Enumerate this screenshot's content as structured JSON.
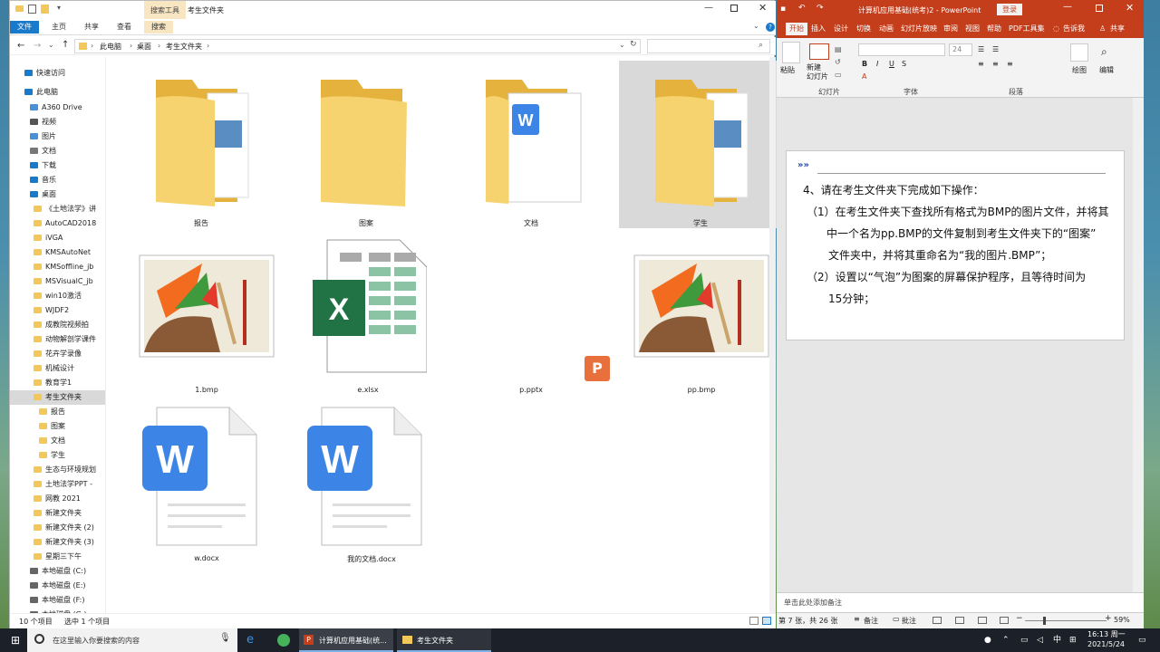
{
  "explorer": {
    "window_title": "考生文件夹",
    "context_tab_group": "搜索工具",
    "ribbon_tabs": [
      "文件",
      "主页",
      "共享",
      "查看",
      "搜索"
    ],
    "breadcrumb": [
      "此电脑",
      "桌面",
      "考生文件夹"
    ],
    "search_placeholder": "",
    "nav_items": [
      {
        "label": "快速访问",
        "kind": "star"
      },
      {
        "label": "此电脑",
        "kind": "pc"
      },
      {
        "label": "A360 Drive",
        "kind": "cloud"
      },
      {
        "label": "视频",
        "kind": "video"
      },
      {
        "label": "图片",
        "kind": "image"
      },
      {
        "label": "文档",
        "kind": "doc"
      },
      {
        "label": "下载",
        "kind": "download"
      },
      {
        "label": "音乐",
        "kind": "music"
      },
      {
        "label": "桌面",
        "kind": "desktop"
      },
      {
        "label": "《土地法学》讲",
        "kind": "folder"
      },
      {
        "label": "AutoCAD2018",
        "kind": "folder"
      },
      {
        "label": "iVGA",
        "kind": "folder"
      },
      {
        "label": "KMSAutoNet",
        "kind": "folder"
      },
      {
        "label": "KMSoffline_jb",
        "kind": "folder"
      },
      {
        "label": "MSVisualC_jb",
        "kind": "folder"
      },
      {
        "label": "win10激活",
        "kind": "folder"
      },
      {
        "label": "WJDF2",
        "kind": "folder"
      },
      {
        "label": "成教院视频拍",
        "kind": "folder"
      },
      {
        "label": "动物解剖学课件",
        "kind": "folder"
      },
      {
        "label": "花卉学录像",
        "kind": "folder"
      },
      {
        "label": "机械设计",
        "kind": "folder"
      },
      {
        "label": "教育学1",
        "kind": "folder"
      },
      {
        "label": "考生文件夹",
        "kind": "folder"
      },
      {
        "label": "报告",
        "kind": "folder"
      },
      {
        "label": "图案",
        "kind": "folder"
      },
      {
        "label": "文档",
        "kind": "folder"
      },
      {
        "label": "学生",
        "kind": "folder"
      },
      {
        "label": "生态与环境规划",
        "kind": "folder"
      },
      {
        "label": "土地法学PPT - ",
        "kind": "folder"
      },
      {
        "label": "网教 2021",
        "kind": "folder"
      },
      {
        "label": "新建文件夹",
        "kind": "folder"
      },
      {
        "label": "新建文件夹 (2)",
        "kind": "folder"
      },
      {
        "label": "新建文件夹 (3)",
        "kind": "folder"
      },
      {
        "label": "星期三下午",
        "kind": "folder"
      },
      {
        "label": "本地磁盘 (C:)",
        "kind": "drive"
      },
      {
        "label": "本地磁盘 (E:)",
        "kind": "drive"
      },
      {
        "label": "本地磁盘 (F:)",
        "kind": "drive"
      },
      {
        "label": "本地磁盘 (G:)",
        "kind": "drive"
      }
    ],
    "files": [
      {
        "name": "报告",
        "type": "folder"
      },
      {
        "name": "图案",
        "type": "folder"
      },
      {
        "name": "文档",
        "type": "folder"
      },
      {
        "name": "学生",
        "type": "folder",
        "selected": true
      },
      {
        "name": "1.bmp",
        "type": "bmp"
      },
      {
        "name": "e.xlsx",
        "type": "xlsx"
      },
      {
        "name": "p.pptx",
        "type": "pptx"
      },
      {
        "name": "pp.bmp",
        "type": "bmp"
      },
      {
        "name": "w.docx",
        "type": "docx"
      },
      {
        "name": "我的文档.docx",
        "type": "docx"
      }
    ],
    "status_count": "10 个项目",
    "status_selected": "选中 1 个项目"
  },
  "ppt": {
    "title": "计算机应用基础(统考)2  -  PowerPoint",
    "login_label": "登录",
    "tabs": [
      "开始",
      "插入",
      "设计",
      "切换",
      "动画",
      "幻灯片放映",
      "审阅",
      "视图",
      "帮助",
      "PDF工具集",
      "告诉我",
      "共享"
    ],
    "ribbon_groups": [
      "幻灯片",
      "字体",
      "段落"
    ],
    "new_slide_label": "新建\n幻灯片",
    "paste_label": "粘贴",
    "drawing_label": "绘图",
    "edit_label": "编辑",
    "font_size": "24",
    "slide_lines": [
      "4、请在考生文件夹下完成如下操作：",
      "（1）在考生文件夹下查找所有格式为BMP的图片文件，并将其",
      "中一个名为pp.BMP的文件复制到考生文件夹下的“图案”",
      "文件夹中，并将其重命名为“我的图片.BMP”；",
      "（2）设置以“气泡”为图案的屏幕保护程序，且等待时间为",
      "15分钟；"
    ],
    "notes_placeholder": "单击此处添加备注",
    "status_slide": "第 7 张，共 26 张",
    "status_notes": "备注",
    "status_comments": "批注",
    "zoom": "59%"
  },
  "taskbar": {
    "search_placeholder": "在这里输入你要搜索的内容",
    "apps": [
      {
        "label": "计算机应用基础(统...",
        "icon": "powerpoint-icon"
      },
      {
        "label": "考生文件夹",
        "icon": "folder-icon"
      }
    ],
    "ime": "中",
    "time": "16:13 周一",
    "date": "2021/5/24"
  },
  "colors": {
    "ppt_accent": "#c43e1c",
    "folder": "#f2c85b",
    "word_blue": "#3c84e5",
    "excel_green": "#217346",
    "ppt_orange": "#e8703c"
  }
}
